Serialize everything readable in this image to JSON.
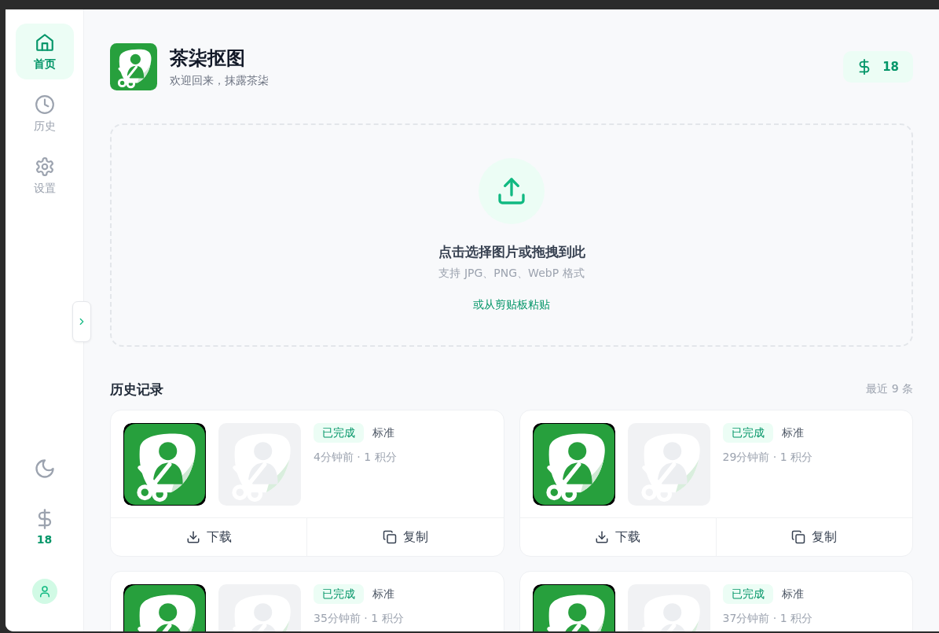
{
  "sidebar": {
    "items": [
      {
        "label": "首页",
        "selected": true
      },
      {
        "label": "历史",
        "selected": false
      },
      {
        "label": "设置",
        "selected": false
      }
    ],
    "credits": "18"
  },
  "header": {
    "title": "茶柒抠图",
    "subtitle": "欢迎回来，抹露茶柒",
    "credits": "18"
  },
  "upload": {
    "title": "点击选择图片或拖拽到此",
    "hint": "支持 JPG、PNG、WebP 格式",
    "paste_link": "或从剪贴板粘贴"
  },
  "history": {
    "title": "历史记录",
    "count": "最近 9 条",
    "items": [
      {
        "status": "已完成",
        "mode": "标准",
        "meta": "4分钟前 · 1 积分",
        "actions": [
          "下载",
          "复制"
        ]
      },
      {
        "status": "已完成",
        "mode": "标准",
        "meta": "29分钟前 · 1 积分",
        "actions": [
          "下载",
          "复制"
        ]
      },
      {
        "status": "已完成",
        "mode": "标准",
        "meta": "35分钟前 · 1 积分"
      },
      {
        "status": "已完成",
        "mode": "标准",
        "meta": "37分钟前 · 1 积分"
      }
    ]
  }
}
